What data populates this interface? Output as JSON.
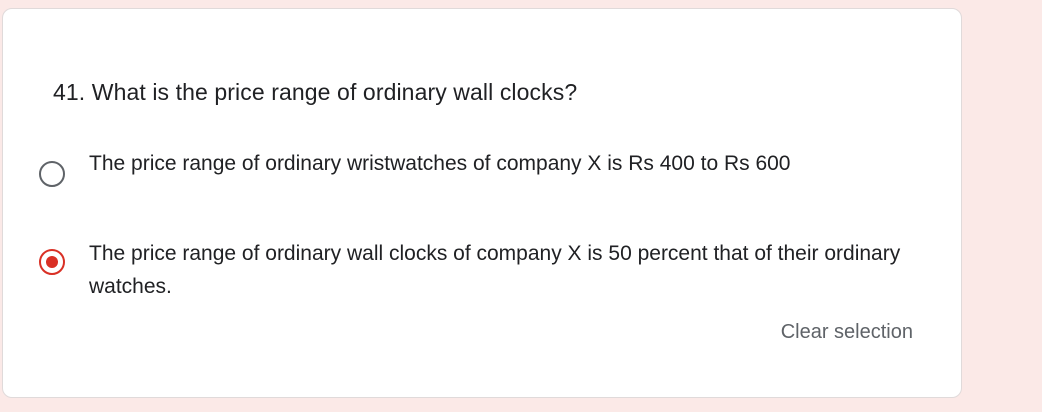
{
  "question": {
    "text": "41. What is the price range of ordinary wall clocks?"
  },
  "options": [
    {
      "label": "The price range of ordinary wristwatches of company X is Rs 400 to Rs 600",
      "selected": false
    },
    {
      "label": "The price range of ordinary wall clocks of company X is 50 percent that of their ordinary watches.",
      "selected": true
    }
  ],
  "actions": {
    "clear_label": "Clear selection"
  },
  "colors": {
    "background": "#fbe9e7",
    "accent": "#d93025",
    "unselected_radio": "#5f6368"
  }
}
